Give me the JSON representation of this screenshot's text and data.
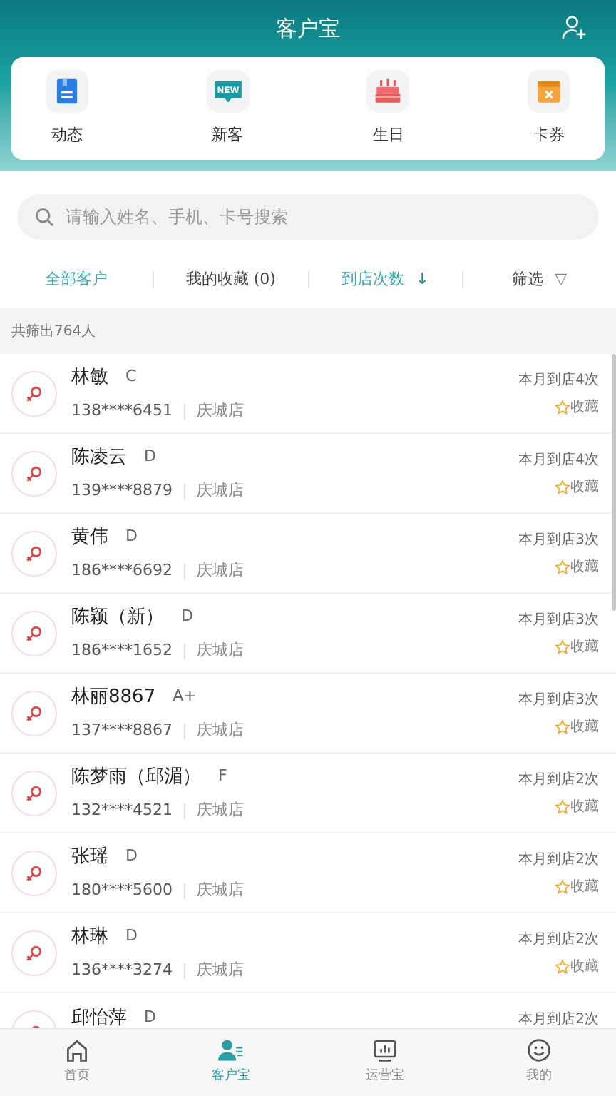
{
  "header": {
    "title": "客户宝"
  },
  "quick_actions": [
    {
      "kind": "feed",
      "label": "动态"
    },
    {
      "kind": "new",
      "label": "新客",
      "badge": "NEW"
    },
    {
      "kind": "birthday",
      "label": "生日"
    },
    {
      "kind": "coupon",
      "label": "卡券"
    }
  ],
  "search": {
    "placeholder": "请输入姓名、手机、卡号搜索"
  },
  "filters": [
    {
      "kind": "tab",
      "label": "全部客户",
      "selected": true
    },
    {
      "kind": "tab",
      "label": "我的收藏 (0)",
      "selected": false
    },
    {
      "kind": "sort",
      "label": "到店次数",
      "arrow": "↓",
      "active": true
    },
    {
      "kind": "filter",
      "label": "筛选",
      "arrow": "▽",
      "active": false
    }
  ],
  "summary": "共筛出764人",
  "customers": [
    {
      "name": "林敏",
      "grade": "C",
      "phone": "138****6451",
      "store": "庆城店",
      "visits": "本月到店4次",
      "favorite_label": "收藏",
      "favorited": false
    },
    {
      "name": "陈凌云",
      "grade": "D",
      "phone": "139****8879",
      "store": "庆城店",
      "visits": "本月到店4次",
      "favorite_label": "收藏",
      "favorited": false
    },
    {
      "name": "黄伟",
      "grade": "D",
      "phone": "186****6692",
      "store": "庆城店",
      "visits": "本月到店3次",
      "favorite_label": "收藏",
      "favorited": false
    },
    {
      "name": "陈颖（新）",
      "grade": "D",
      "phone": "186****1652",
      "store": "庆城店",
      "visits": "本月到店3次",
      "favorite_label": "收藏",
      "favorited": false
    },
    {
      "name": "林丽8867",
      "grade": "A+",
      "phone": "137****8867",
      "store": "庆城店",
      "visits": "本月到店3次",
      "favorite_label": "收藏",
      "favorited": false
    },
    {
      "name": "陈梦雨（邱湄）",
      "grade": "F",
      "phone": "132****4521",
      "store": "庆城店",
      "visits": "本月到店2次",
      "favorite_label": "收藏",
      "favorited": false
    },
    {
      "name": "张瑶",
      "grade": "D",
      "phone": "180****5600",
      "store": "庆城店",
      "visits": "本月到店2次",
      "favorite_label": "收藏",
      "favorited": false
    },
    {
      "name": "林琳",
      "grade": "D",
      "phone": "136****3274",
      "store": "庆城店",
      "visits": "本月到店2次",
      "favorite_label": "收藏",
      "favorited": false
    },
    {
      "name": "邱怡萍",
      "grade": "D",
      "visits": "本月到店2次"
    }
  ],
  "nav": [
    {
      "kind": "home",
      "label": "首页",
      "selected": false
    },
    {
      "kind": "customers",
      "label": "客户宝",
      "selected": true
    },
    {
      "kind": "operations",
      "label": "运营宝",
      "selected": false
    },
    {
      "kind": "me",
      "label": "我的",
      "selected": false
    }
  ]
}
